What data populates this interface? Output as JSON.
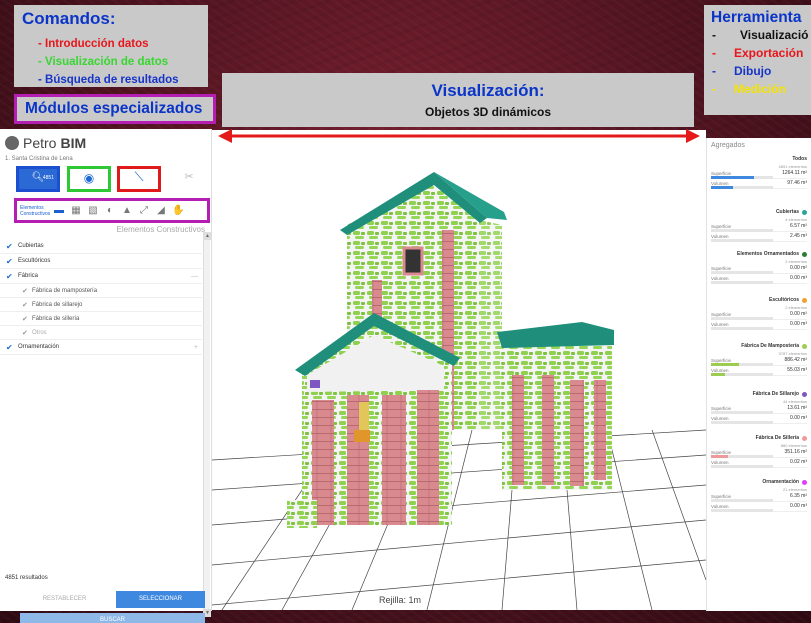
{
  "commands": {
    "title": "Comandos:",
    "items": [
      "- Introducción datos",
      "- Visualización de datos",
      "- Búsqueda de resultados"
    ]
  },
  "modules_label": "Módulos especializados",
  "visualization": {
    "title": "Visualización:",
    "subtitle": "Objetos 3D dinámicos"
  },
  "tools": {
    "title": "Herramienta",
    "items": [
      "Visualizació",
      "Exportación",
      "Dibujo",
      "Medición"
    ]
  },
  "app": {
    "logo": "Petro",
    "logo_suffix": "BIM",
    "project": "1. Santa Cristina de Lena",
    "search_count": "4851",
    "element_bar_label": "Elementos Constructivos",
    "section_title": "Elementos Constructivos",
    "tree": [
      {
        "label": "Cubiertas",
        "level": 0
      },
      {
        "label": "Escultóricos",
        "level": 0
      },
      {
        "label": "Fábrica",
        "level": 0,
        "chev": "—"
      },
      {
        "label": "Fábrica de mampostería",
        "level": 1
      },
      {
        "label": "Fábrica de sillarejo",
        "level": 1
      },
      {
        "label": "Fábrica de sillería",
        "level": 1
      },
      {
        "label": "Otros",
        "level": 1,
        "disabled": true
      },
      {
        "label": "Ornamentación",
        "level": 0,
        "chev": "+"
      }
    ],
    "results": "4851 resultados",
    "reset_label": "RESTABLECER",
    "select_label": "SELECCIONAR",
    "search_label": "BUSCAR",
    "grid_label": "Rejilla: 1m"
  },
  "aggregates": {
    "title": "Agregados",
    "surface_label": "Superficie",
    "volume_label": "Volumen",
    "groups": [
      {
        "name": "Todos",
        "count": "4851 elementos",
        "surface": "1264.11 m²",
        "volume": "97.46 m³",
        "color": "",
        "surface_fill": 0.7,
        "volume_fill": 0.35
      },
      {
        "name": "Cubiertas",
        "count": "4 elementos",
        "surface": "6.57 m²",
        "volume": "2.45 m³",
        "color": "#26a69a",
        "surface_fill": 0,
        "volume_fill": 0
      },
      {
        "name": "Elementos Ornamentados",
        "count": "2 elementos",
        "surface": "0.00 m²",
        "volume": "0.00 m³",
        "color": "#2e7d32",
        "surface_fill": 0,
        "volume_fill": 0
      },
      {
        "name": "Escultóricos",
        "count": "2 elementos",
        "surface": "0.00 m²",
        "volume": "0.00 m³",
        "color": "#f0a030",
        "surface_fill": 0,
        "volume_fill": 0
      },
      {
        "name": "Fábrica De Mampostería",
        "count": "3787 elementos",
        "surface": "886.42 m²",
        "volume": "55.03 m³",
        "color": "#9ccc50",
        "surface_fill": 0.45,
        "volume_fill": 0.22
      },
      {
        "name": "Fábrica De Sillarejo",
        "count": "44 elementos",
        "surface": "13.61 m²",
        "volume": "0.00 m³",
        "color": "#7e57c2",
        "surface_fill": 0,
        "volume_fill": 0
      },
      {
        "name": "Fábrica De Sillería",
        "count": "880 elementos",
        "surface": "351.16 m²",
        "volume": "0.02 m³",
        "color": "#ef9a9a",
        "surface_fill": 0.28,
        "volume_fill": 0
      },
      {
        "name": "Ornamentación",
        "count": "21 elementos",
        "surface": "6.35 m²",
        "volume": "0.00 m³",
        "color": "#e040fb",
        "surface_fill": 0,
        "volume_fill": 0
      }
    ]
  }
}
